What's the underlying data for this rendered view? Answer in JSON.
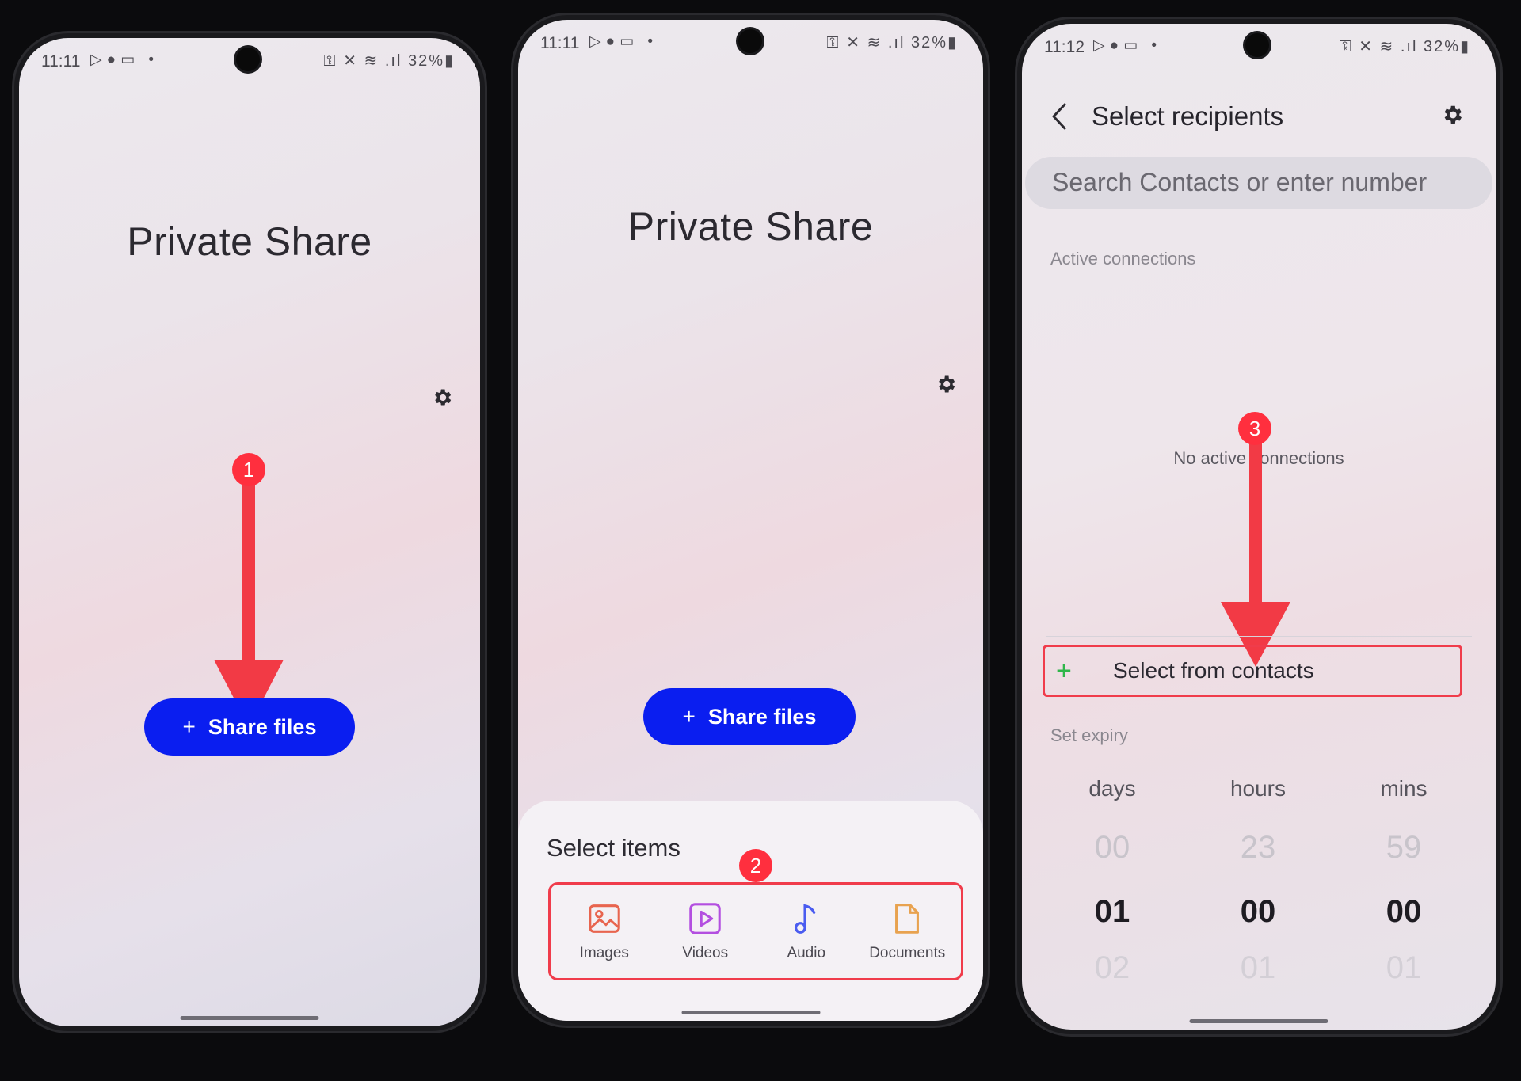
{
  "status_bar": {
    "phone1": {
      "time": "11:11",
      "battery": "32%"
    },
    "phone2": {
      "time": "11:11",
      "battery": "32%"
    },
    "phone3": {
      "time": "11:12",
      "battery": "32%"
    }
  },
  "app": {
    "title": "Private Share"
  },
  "share_button": {
    "plus": "+",
    "label": "Share files"
  },
  "step_badges": [
    "1",
    "2",
    "3"
  ],
  "select_items": {
    "title": "Select items",
    "items": [
      {
        "label": "Images",
        "icon": "image-icon",
        "color": "#e8654f"
      },
      {
        "label": "Videos",
        "icon": "video-icon",
        "color": "#b34fe0"
      },
      {
        "label": "Audio",
        "icon": "music-note-icon",
        "color": "#4a5cf0"
      },
      {
        "label": "Documents",
        "icon": "document-icon",
        "color": "#e8a24f"
      }
    ]
  },
  "recipients": {
    "title": "Select recipients",
    "search_placeholder": "Search Contacts or enter number",
    "active_label": "Active connections",
    "empty_message": "No active connections",
    "select_contacts_plus": "+",
    "select_contacts_label": "Select from contacts",
    "expiry_label": "Set expiry",
    "picker": {
      "days": {
        "label": "days",
        "prev": "00",
        "current": "01",
        "next": "02"
      },
      "hours": {
        "label": "hours",
        "prev": "23",
        "current": "00",
        "next": "01"
      },
      "mins": {
        "label": "mins",
        "prev": "59",
        "current": "00",
        "next": "01"
      }
    }
  },
  "colors": {
    "accent_blue": "#0a1ef0",
    "highlight_red": "#f03c4b",
    "plus_green": "#2fb64a"
  }
}
